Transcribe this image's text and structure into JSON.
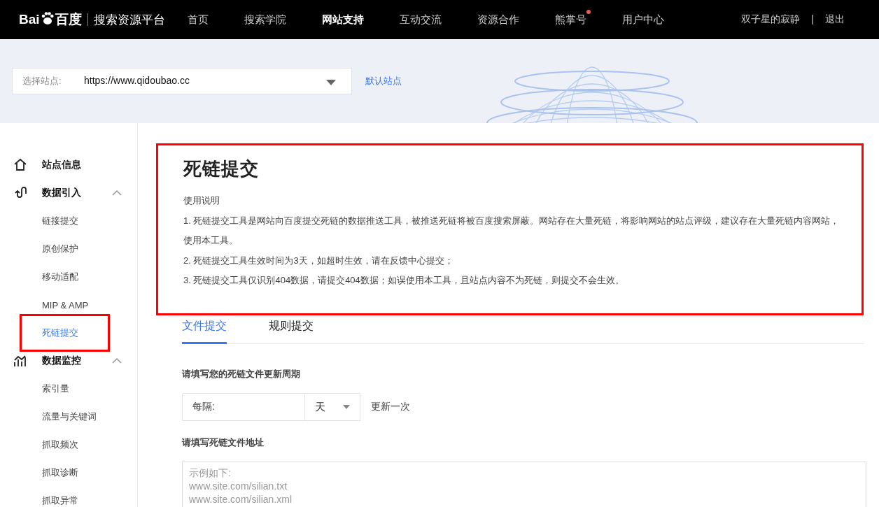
{
  "header": {
    "logo_latin": "Bai",
    "logo_cn": "百度",
    "platform": "搜索资源平台",
    "nav": [
      {
        "label": "首页",
        "selected": false,
        "badge": false
      },
      {
        "label": "搜索学院",
        "selected": false,
        "badge": false
      },
      {
        "label": "网站支持",
        "selected": true,
        "badge": false
      },
      {
        "label": "互动交流",
        "selected": false,
        "badge": false
      },
      {
        "label": "资源合作",
        "selected": false,
        "badge": false
      },
      {
        "label": "熊掌号",
        "selected": false,
        "badge": true
      },
      {
        "label": "用户中心",
        "selected": false,
        "badge": false
      }
    ],
    "user": "双子星的寂静",
    "separator": "|",
    "logout": "退出"
  },
  "site_picker": {
    "label": "选择站点:",
    "value": "https://www.qidoubao.cc",
    "default_link": "默认站点"
  },
  "sidebar": {
    "items": [
      {
        "label": "站点信息"
      },
      {
        "label": "数据引入",
        "expanded": true,
        "children": [
          {
            "label": "链接提交",
            "selected": false,
            "highlighted": false
          },
          {
            "label": "原创保护",
            "selected": false,
            "highlighted": false
          },
          {
            "label": "移动适配",
            "selected": false,
            "highlighted": false
          },
          {
            "label": "MIP & AMP",
            "selected": false,
            "highlighted": false
          },
          {
            "label": "死链提交",
            "selected": true,
            "highlighted": true
          }
        ]
      },
      {
        "label": "数据监控",
        "expanded": true,
        "children": [
          {
            "label": "索引量",
            "selected": false,
            "highlighted": false
          },
          {
            "label": "流量与关键词",
            "selected": false,
            "highlighted": false
          },
          {
            "label": "抓取频次",
            "selected": false,
            "highlighted": false
          },
          {
            "label": "抓取诊断",
            "selected": false,
            "highlighted": false
          },
          {
            "label": "抓取异常",
            "selected": false,
            "highlighted": false
          }
        ]
      }
    ]
  },
  "intro": {
    "highlighted": true,
    "title": "死链提交",
    "subtitle": "使用说明",
    "lines": [
      "1. 死链提交工具是网站向百度提交死链的数据推送工具，被推送死链将被百度搜索屏蔽。网站存在大量死链，将影响网站的站点评级，建议存在大量死链内容网站，使用本工具。",
      "2. 死链提交工具生效时间为3天，如超时生效，请在反馈中心提交；",
      "3. 死链提交工具仅识别404数据，请提交404数据；如误使用本工具，且站点内容不为死链，则提交不会生效。"
    ]
  },
  "tabs": [
    {
      "label": "文件提交",
      "selected": true
    },
    {
      "label": "规则提交",
      "selected": false
    }
  ],
  "form": {
    "period_label": "请填写您的死链文件更新周期",
    "interval_label": "每隔:",
    "unit": "天",
    "suffix": "更新一次",
    "address_label": "请填写死链文件地址",
    "address_placeholder": "示例如下:\nwww.site.com/silian.txt\nwww.site.com/silian.xml"
  }
}
